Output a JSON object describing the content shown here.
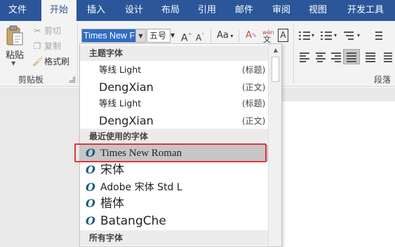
{
  "tabs": [
    "文件",
    "开始",
    "插入",
    "设计",
    "布局",
    "引用",
    "邮件",
    "审阅",
    "视图",
    "开发工具"
  ],
  "active_tab": "开始",
  "clipboard": {
    "paste_label": "粘贴",
    "cut_label": "剪切",
    "copy_label": "复制",
    "format_painter_label": "格式刷",
    "group_label": "剪贴板"
  },
  "font": {
    "name_value": "Times New F",
    "size_value": "五号",
    "grow_glyph": "A",
    "shrink_glyph": "A",
    "case_glyph": "Aa",
    "pinyin_glyph": "wén",
    "border_glyph": "A"
  },
  "paragraph": {
    "group_label": "段落"
  },
  "dropdown": {
    "theme_header": "主题字体",
    "theme_fonts": [
      {
        "name": "等线 Light",
        "tag": "(标题)"
      },
      {
        "name": "DengXian",
        "tag": "(正文)"
      },
      {
        "name": "等线 Light",
        "tag": "(标题)"
      },
      {
        "name": "DengXian",
        "tag": "(正文)"
      }
    ],
    "recent_header": "最近使用的字体",
    "recent_fonts": [
      "Times New Roman",
      "宋体",
      "Adobe 宋体 Std L",
      "楷体",
      "BatangChe"
    ],
    "all_header": "所有字体",
    "font_icon": "O",
    "selected_font": "Times New Roman"
  },
  "colors": {
    "tabbar": "#2b579a",
    "selection_box": "#e3343b",
    "font_icon": "#1c5d7d"
  }
}
